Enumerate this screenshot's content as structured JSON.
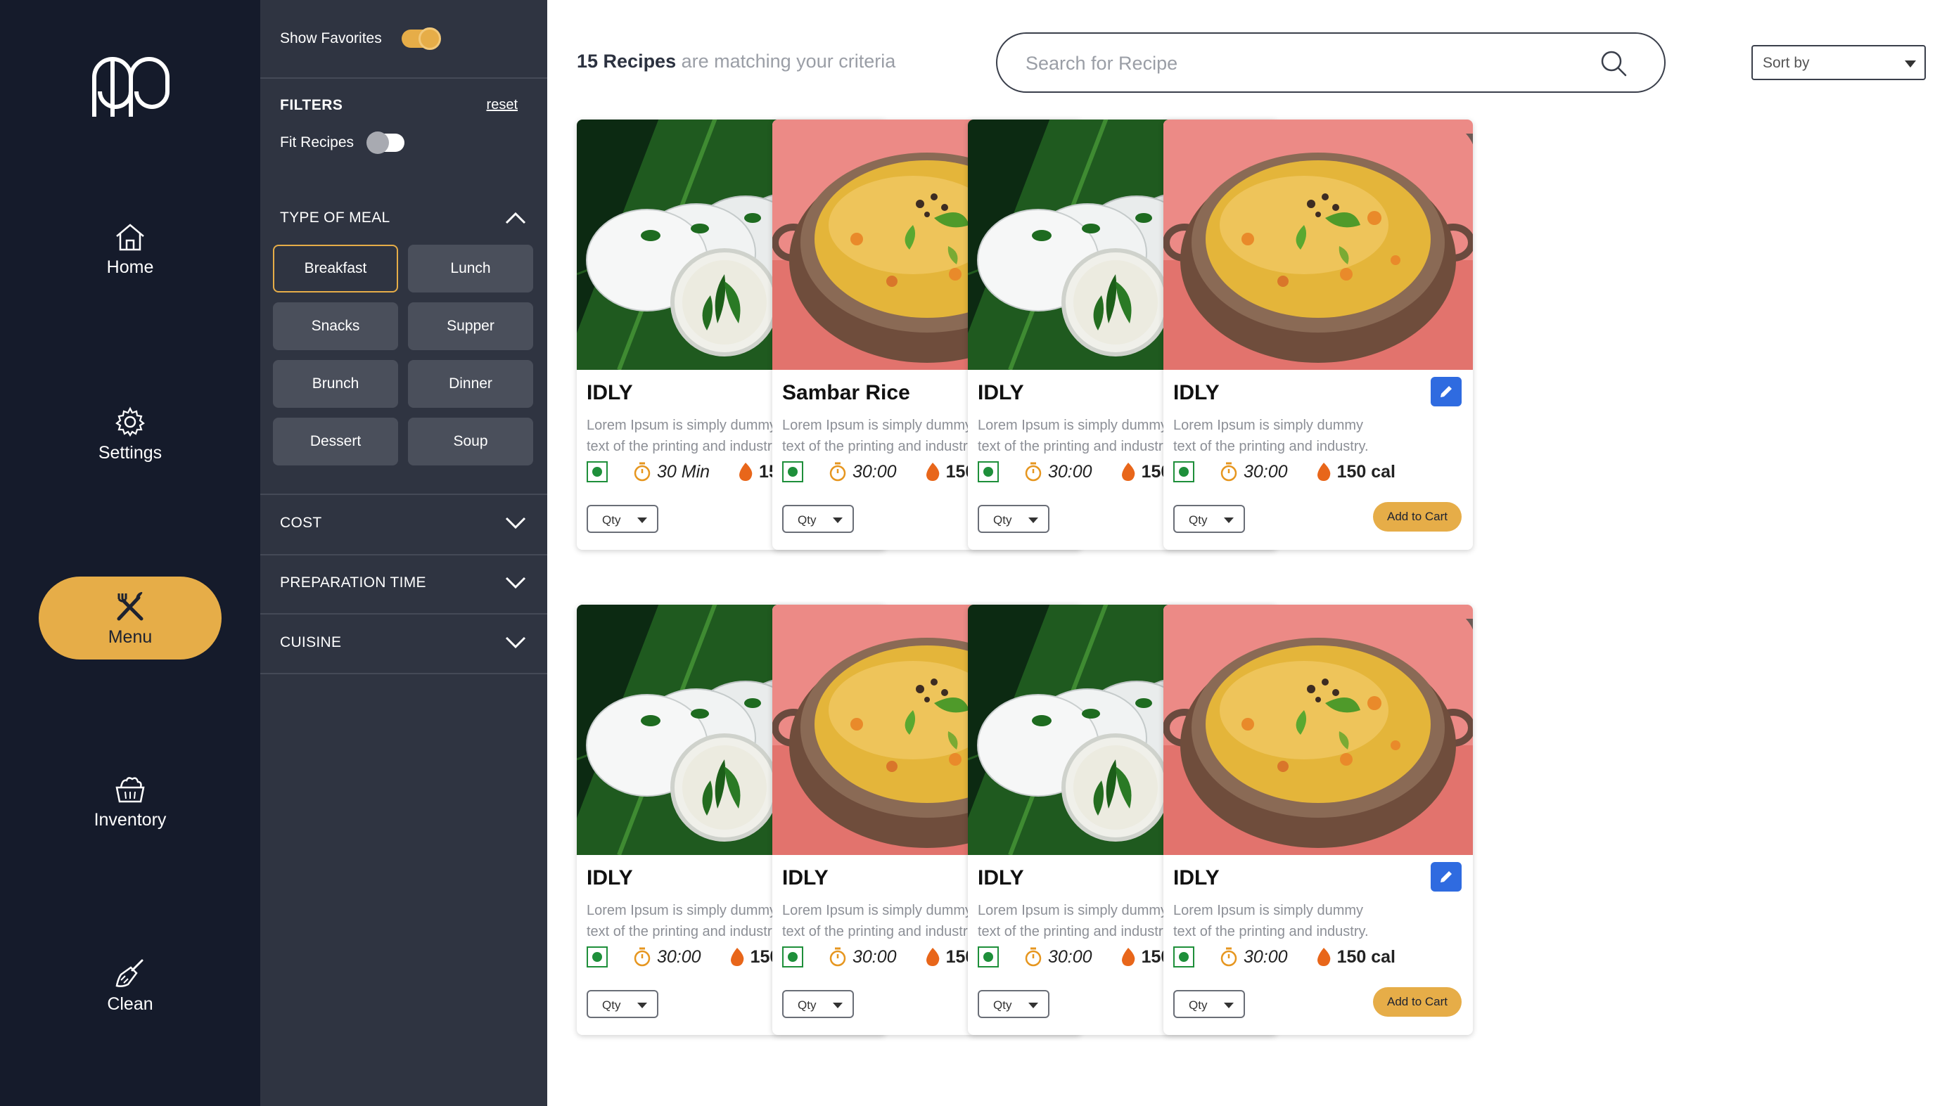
{
  "nav": {
    "logo_icon": "app-logo-icon",
    "items": [
      {
        "label": "Home",
        "icon": "home-icon"
      },
      {
        "label": "Settings",
        "icon": "gear-icon"
      },
      {
        "label": "Menu",
        "icon": "fork-knife-icon",
        "active": true
      },
      {
        "label": "Inventory",
        "icon": "basket-icon"
      },
      {
        "label": "Clean",
        "icon": "broom-icon"
      }
    ]
  },
  "filters": {
    "show_favorites_label": "Show Favorites",
    "show_favorites_on": true,
    "title": "FILTERS",
    "reset_label": "reset",
    "fit_recipes_label": "Fit Recipes",
    "fit_recipes_on": false,
    "type_of_meal_label": "TYPE OF MEAL",
    "meals": [
      "Breakfast",
      "Lunch",
      "Snacks",
      "Supper",
      "Brunch",
      "Dinner",
      "Dessert",
      "Soup"
    ],
    "selected_meal": "Breakfast",
    "cost_label": "COST",
    "prep_time_label": "PREPARATION TIME",
    "cuisine_label": "CUISINE"
  },
  "header": {
    "count_bold": "15 Recipes",
    "count_rest": " are matching your criteria",
    "search_placeholder": "Search for Recipe",
    "sort_label": "Sort by"
  },
  "colors": {
    "nav_bg": "#151b2b",
    "panel_bg": "#2f3441",
    "accent": "#e6ad48",
    "edit_blue": "#2f6be0",
    "veg_green": "#1e8f3a"
  },
  "cards": [
    {
      "name": "IDLY",
      "image": "idly",
      "desc1": "Lorem Ipsum is simply dummy",
      "desc2": "text of the printing and industry.",
      "time": "30 Min",
      "cal": "150 cal",
      "qty": "Qty",
      "cart": "Add to Cart"
    },
    {
      "name": "Sambar Rice",
      "image": "sambar-rice",
      "desc1": "Lorem Ipsum is simply dummy",
      "desc2": "text of the printing and industry.",
      "time": "30:00",
      "cal": "150 cal",
      "qty": "Qty",
      "cart": "Add to Cart"
    },
    {
      "name": "IDLY",
      "image": "idly",
      "desc1": "Lorem Ipsum is simply dummy",
      "desc2": "text of the printing and industry.",
      "time": "30:00",
      "cal": "150 cal",
      "qty": "Qty",
      "cart": "Add to Cart"
    },
    {
      "name": "IDLY",
      "image": "sambar-rice",
      "desc1": "Lorem Ipsum is simply dummy",
      "desc2": "text of the printing and industry.",
      "time": "30:00",
      "cal": "150 cal",
      "qty": "Qty",
      "cart": "Add to Cart"
    },
    {
      "name": "IDLY",
      "image": "idly",
      "desc1": "Lorem Ipsum is simply dummy",
      "desc2": "text of the printing and industry.",
      "time": "30:00",
      "cal": "150 cal",
      "qty": "Qty",
      "cart": "Add to Cart"
    },
    {
      "name": "IDLY",
      "image": "sambar-rice",
      "desc1": "Lorem Ipsum is simply dummy",
      "desc2": "text of the printing and industry.",
      "time": "30:00",
      "cal": "150 cal",
      "qty": "Qty",
      "cart": "Add to Cart"
    },
    {
      "name": "IDLY",
      "image": "idly",
      "desc1": "Lorem Ipsum is simply dummy",
      "desc2": "text of the printing and industry.",
      "time": "30:00",
      "cal": "150 cal",
      "qty": "Qty",
      "cart": "Add to Cart"
    },
    {
      "name": "IDLY",
      "image": "sambar-rice",
      "desc1": "Lorem Ipsum is simply dummy",
      "desc2": "text of the printing and industry.",
      "time": "30:00",
      "cal": "150 cal",
      "qty": "Qty",
      "cart": "Add to Cart"
    }
  ]
}
